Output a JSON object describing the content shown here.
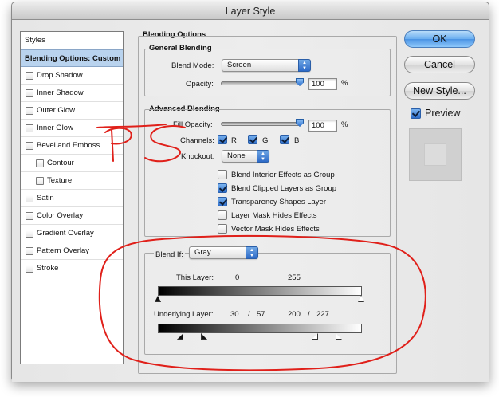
{
  "window": {
    "title": "Layer Style"
  },
  "sidebar": {
    "header": "Styles",
    "items": [
      {
        "label": "Blending Options: Custom",
        "checkbox": false,
        "selected": true,
        "indent": 0
      },
      {
        "label": "Drop Shadow",
        "checkbox": true,
        "checked": false,
        "indent": 0
      },
      {
        "label": "Inner Shadow",
        "checkbox": true,
        "checked": false,
        "indent": 0
      },
      {
        "label": "Outer Glow",
        "checkbox": true,
        "checked": false,
        "indent": 0
      },
      {
        "label": "Inner Glow",
        "checkbox": true,
        "checked": false,
        "indent": 0
      },
      {
        "label": "Bevel and Emboss",
        "checkbox": true,
        "checked": false,
        "indent": 0
      },
      {
        "label": "Contour",
        "checkbox": true,
        "checked": false,
        "indent": 1
      },
      {
        "label": "Texture",
        "checkbox": true,
        "checked": false,
        "indent": 1
      },
      {
        "label": "Satin",
        "checkbox": true,
        "checked": false,
        "indent": 0
      },
      {
        "label": "Color Overlay",
        "checkbox": true,
        "checked": false,
        "indent": 0
      },
      {
        "label": "Gradient Overlay",
        "checkbox": true,
        "checked": false,
        "indent": 0
      },
      {
        "label": "Pattern Overlay",
        "checkbox": true,
        "checked": false,
        "indent": 0
      },
      {
        "label": "Stroke",
        "checkbox": true,
        "checked": false,
        "indent": 0
      }
    ]
  },
  "blending_options": {
    "title": "Blending Options",
    "general": {
      "title": "General Blending",
      "blend_mode_label": "Blend Mode:",
      "blend_mode_value": "Screen",
      "opacity_label": "Opacity:",
      "opacity_value": "100",
      "opacity_unit": "%"
    },
    "advanced": {
      "title": "Advanced Blending",
      "fill_opacity_label": "Fill Opacity:",
      "fill_opacity_value": "100",
      "fill_opacity_unit": "%",
      "channels_label": "Channels:",
      "channels": [
        {
          "label": "R",
          "checked": true
        },
        {
          "label": "G",
          "checked": true
        },
        {
          "label": "B",
          "checked": true
        }
      ],
      "knockout_label": "Knockout:",
      "knockout_value": "None",
      "options": [
        {
          "label": "Blend Interior Effects as Group",
          "checked": false
        },
        {
          "label": "Blend Clipped Layers as Group",
          "checked": true
        },
        {
          "label": "Transparency Shapes Layer",
          "checked": true
        },
        {
          "label": "Layer Mask Hides Effects",
          "checked": false
        },
        {
          "label": "Vector Mask Hides Effects",
          "checked": false
        }
      ]
    },
    "blend_if": {
      "label": "Blend If:",
      "value": "Gray",
      "this_layer_label": "This Layer:",
      "this_layer_low": "0",
      "this_layer_high": "255",
      "underlying_label": "Underlying Layer:",
      "underlying_low_a": "30",
      "underlying_low_sep": "/",
      "underlying_low_b": "57",
      "underlying_high_a": "200",
      "underlying_high_sep": "/",
      "underlying_high_b": "227"
    }
  },
  "buttons": {
    "ok": "OK",
    "cancel": "Cancel",
    "new_style": "New Style...",
    "preview_label": "Preview",
    "preview_checked": true
  },
  "annotation": {
    "color": "#e0201a"
  }
}
